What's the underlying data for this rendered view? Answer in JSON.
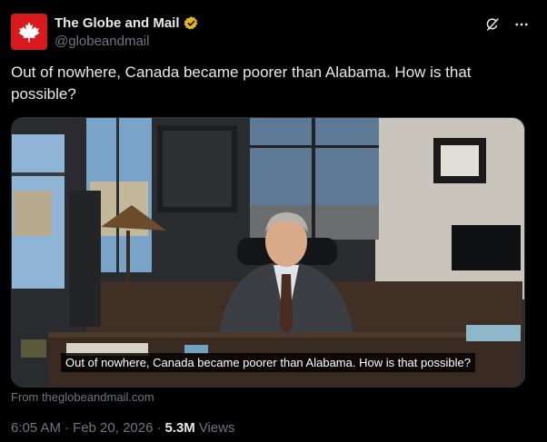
{
  "author": {
    "display_name": "The Globe and Mail",
    "handle": "@globeandmail",
    "avatar_color": "#d71920",
    "verified_badge": "gold-check"
  },
  "tweet": {
    "text": "Out of nowhere, Canada became poorer than Alabama. How is that possible?"
  },
  "media": {
    "caption": "Out of nowhere, Canada became poorer than Alabama. How is that possible?",
    "source": "From theglobeandmail.com"
  },
  "meta": {
    "time": "6:05 AM",
    "date": "Feb 20, 2026",
    "views_count": "5.3M",
    "views_label": "Views",
    "separator": "·"
  },
  "icons": [
    "grok-icon",
    "more-icon",
    "maple-leaf-icon",
    "verified-badge-icon"
  ]
}
